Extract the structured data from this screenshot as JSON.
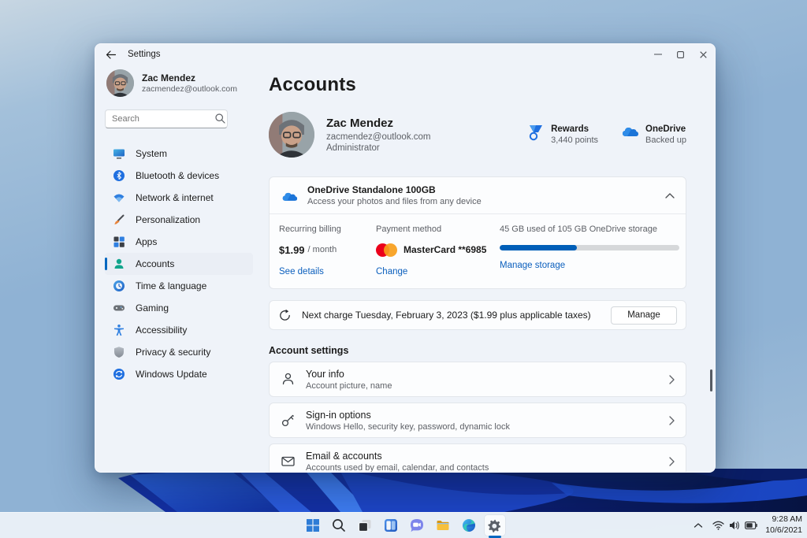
{
  "colors": {
    "accent": "#0067c0",
    "link": "#0b5fbd",
    "progress_fill": "#005fb8",
    "mastercard_red": "#eb001b",
    "mastercard_orange": "#f79e1b",
    "onedrive_blue": "#0364b8"
  },
  "titlebar": {
    "app_title": "Settings"
  },
  "sidebar": {
    "user": {
      "name": "Zac Mendez",
      "email": "zacmendez@outlook.com"
    },
    "search": {
      "placeholder": "Search"
    },
    "items": [
      {
        "label": "System"
      },
      {
        "label": "Bluetooth & devices"
      },
      {
        "label": "Network & internet"
      },
      {
        "label": "Personalization"
      },
      {
        "label": "Apps"
      },
      {
        "label": "Accounts",
        "selected": true
      },
      {
        "label": "Time & language"
      },
      {
        "label": "Gaming"
      },
      {
        "label": "Accessibility"
      },
      {
        "label": "Privacy & security"
      },
      {
        "label": "Windows Update"
      }
    ]
  },
  "main": {
    "page_title": "Accounts",
    "profile": {
      "name": "Zac Mendez",
      "email": "zacmendez@outlook.com",
      "role": "Administrator"
    },
    "rewards": {
      "title": "Rewards",
      "subtitle": "3,440 points"
    },
    "onedrive_status": {
      "title": "OneDrive",
      "subtitle": "Backed up"
    },
    "onedrive_card": {
      "title": "OneDrive Standalone 100GB",
      "subtitle": "Access your photos and files from any device",
      "billing": {
        "label": "Recurring billing",
        "price": "$1.99",
        "period": "/ month",
        "link": "See details"
      },
      "payment": {
        "label": "Payment method",
        "method": "MasterCard **6985",
        "link": "Change"
      },
      "storage": {
        "label": "45 GB used of 105 GB OneDrive storage",
        "used_gb": 45,
        "total_gb": 105,
        "link": "Manage storage"
      }
    },
    "next_charge": {
      "text": "Next charge Tuesday, February 3, 2023 ($1.99 plus applicable taxes)",
      "button": "Manage"
    },
    "account_settings": {
      "heading": "Account settings",
      "rows": [
        {
          "title": "Your info",
          "subtitle": "Account picture, name"
        },
        {
          "title": "Sign-in options",
          "subtitle": "Windows Hello, security key, password, dynamic lock"
        },
        {
          "title": "Email & accounts",
          "subtitle": "Accounts used by email, calendar, and contacts"
        }
      ]
    }
  },
  "taskbar": {
    "clock": {
      "time": "9:28 AM",
      "date": "10/6/2021"
    }
  }
}
